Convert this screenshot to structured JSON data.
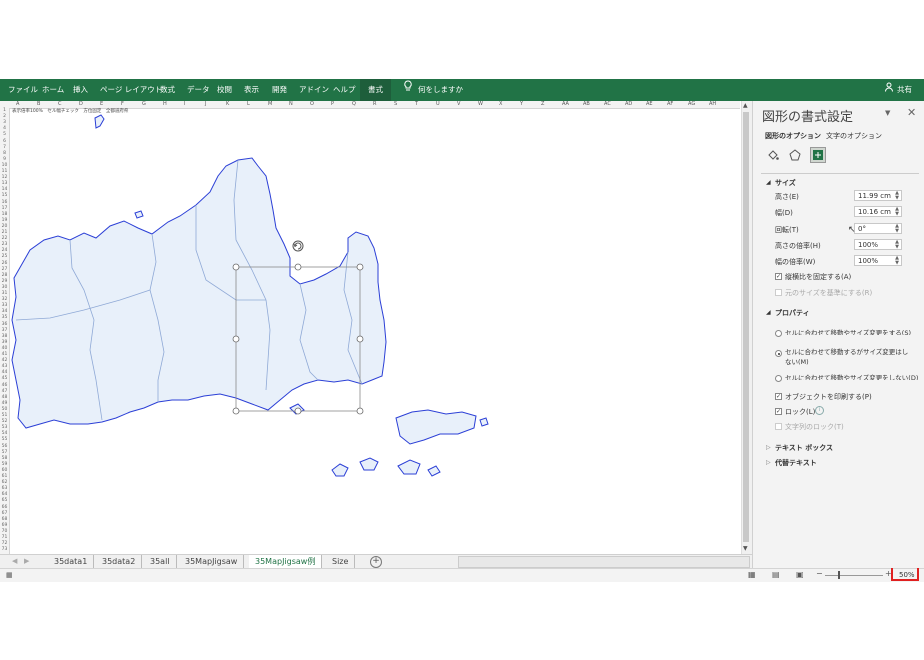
{
  "ribbon": {
    "tabs": [
      "ファイル",
      "ホーム",
      "挿入",
      "ページ レイアウト",
      "数式",
      "データ",
      "校閲",
      "表示",
      "開発",
      "アドイン",
      "ヘルプ",
      "書式"
    ],
    "search_hint": "何をしますか",
    "share": "共有"
  },
  "sheet": {
    "cell_note": "表示倍率100%　セル幅チェック　方位固定　全都道府県",
    "columns": [
      "A",
      "B",
      "C",
      "D",
      "E",
      "F",
      "G",
      "H",
      "I",
      "J",
      "K",
      "L",
      "M",
      "N",
      "O",
      "P",
      "Q",
      "R",
      "S",
      "T",
      "U",
      "V",
      "W",
      "X",
      "Y",
      "Z",
      "AA",
      "AB",
      "AC",
      "AD",
      "AE",
      "AF",
      "AG",
      "AH"
    ],
    "rows": [
      "1",
      "2",
      "3",
      "4",
      "5",
      "6",
      "7",
      "8",
      "9",
      "10",
      "11",
      "12",
      "13",
      "14",
      "15",
      "16",
      "17",
      "18",
      "19",
      "20",
      "21",
      "22",
      "23",
      "24",
      "25",
      "26",
      "27",
      "28",
      "29",
      "30",
      "31",
      "32",
      "33",
      "34",
      "35",
      "36",
      "37",
      "38",
      "39",
      "40",
      "41",
      "42",
      "43",
      "44",
      "45",
      "46",
      "47",
      "48",
      "49",
      "50",
      "51",
      "52",
      "53",
      "54",
      "55",
      "56",
      "57",
      "58",
      "59",
      "60",
      "61",
      "62",
      "63",
      "64",
      "65",
      "66",
      "67",
      "68",
      "69",
      "70",
      "71",
      "72",
      "73"
    ],
    "tabs": [
      "35data1",
      "35data2",
      "35all",
      "35MapJigsaw",
      "35MapJigsaw例",
      "Size"
    ],
    "active_tab": "35MapJigsaw例"
  },
  "pane": {
    "title": "図形の書式設定",
    "tab_shape": "図形のオプション",
    "tab_text": "文字のオプション",
    "size_section": "サイズ",
    "height_label": "高さ(E)",
    "height_value": "11.99 cm",
    "width_label": "幅(D)",
    "width_value": "10.16 cm",
    "rotation_label": "回転(T)",
    "rotation_value": "0°",
    "scale_h_label": "高さの倍率(H)",
    "scale_h_value": "100%",
    "scale_w_label": "幅の倍率(W)",
    "scale_w_value": "100%",
    "lock_ratio": "縦横比を固定する(A)",
    "relative_original": "元のサイズを基準にする(R)",
    "props_section": "プロパティ",
    "radio1": "セルに合わせて移動やサイズ変更をする(S)",
    "radio2_line1": "セルに合わせて移動するがサイズ変更はし",
    "radio2_line2": "ない(M)",
    "radio3": "セルに合わせて移動やサイズ変更をしない(D)",
    "print_object": "オブジェクトを印刷する(P)",
    "lock": "ロック(L)",
    "text_lock": "文字列のロック(T)",
    "textbox": "テキスト ボックス",
    "alt_text": "代替テキスト"
  },
  "status": {
    "zoom": "50%"
  },
  "colors": {
    "ribbon": "#217346",
    "map_fill": "#e8f0fa",
    "map_stroke": "#2b3fd6",
    "highlight": "#e02020"
  }
}
